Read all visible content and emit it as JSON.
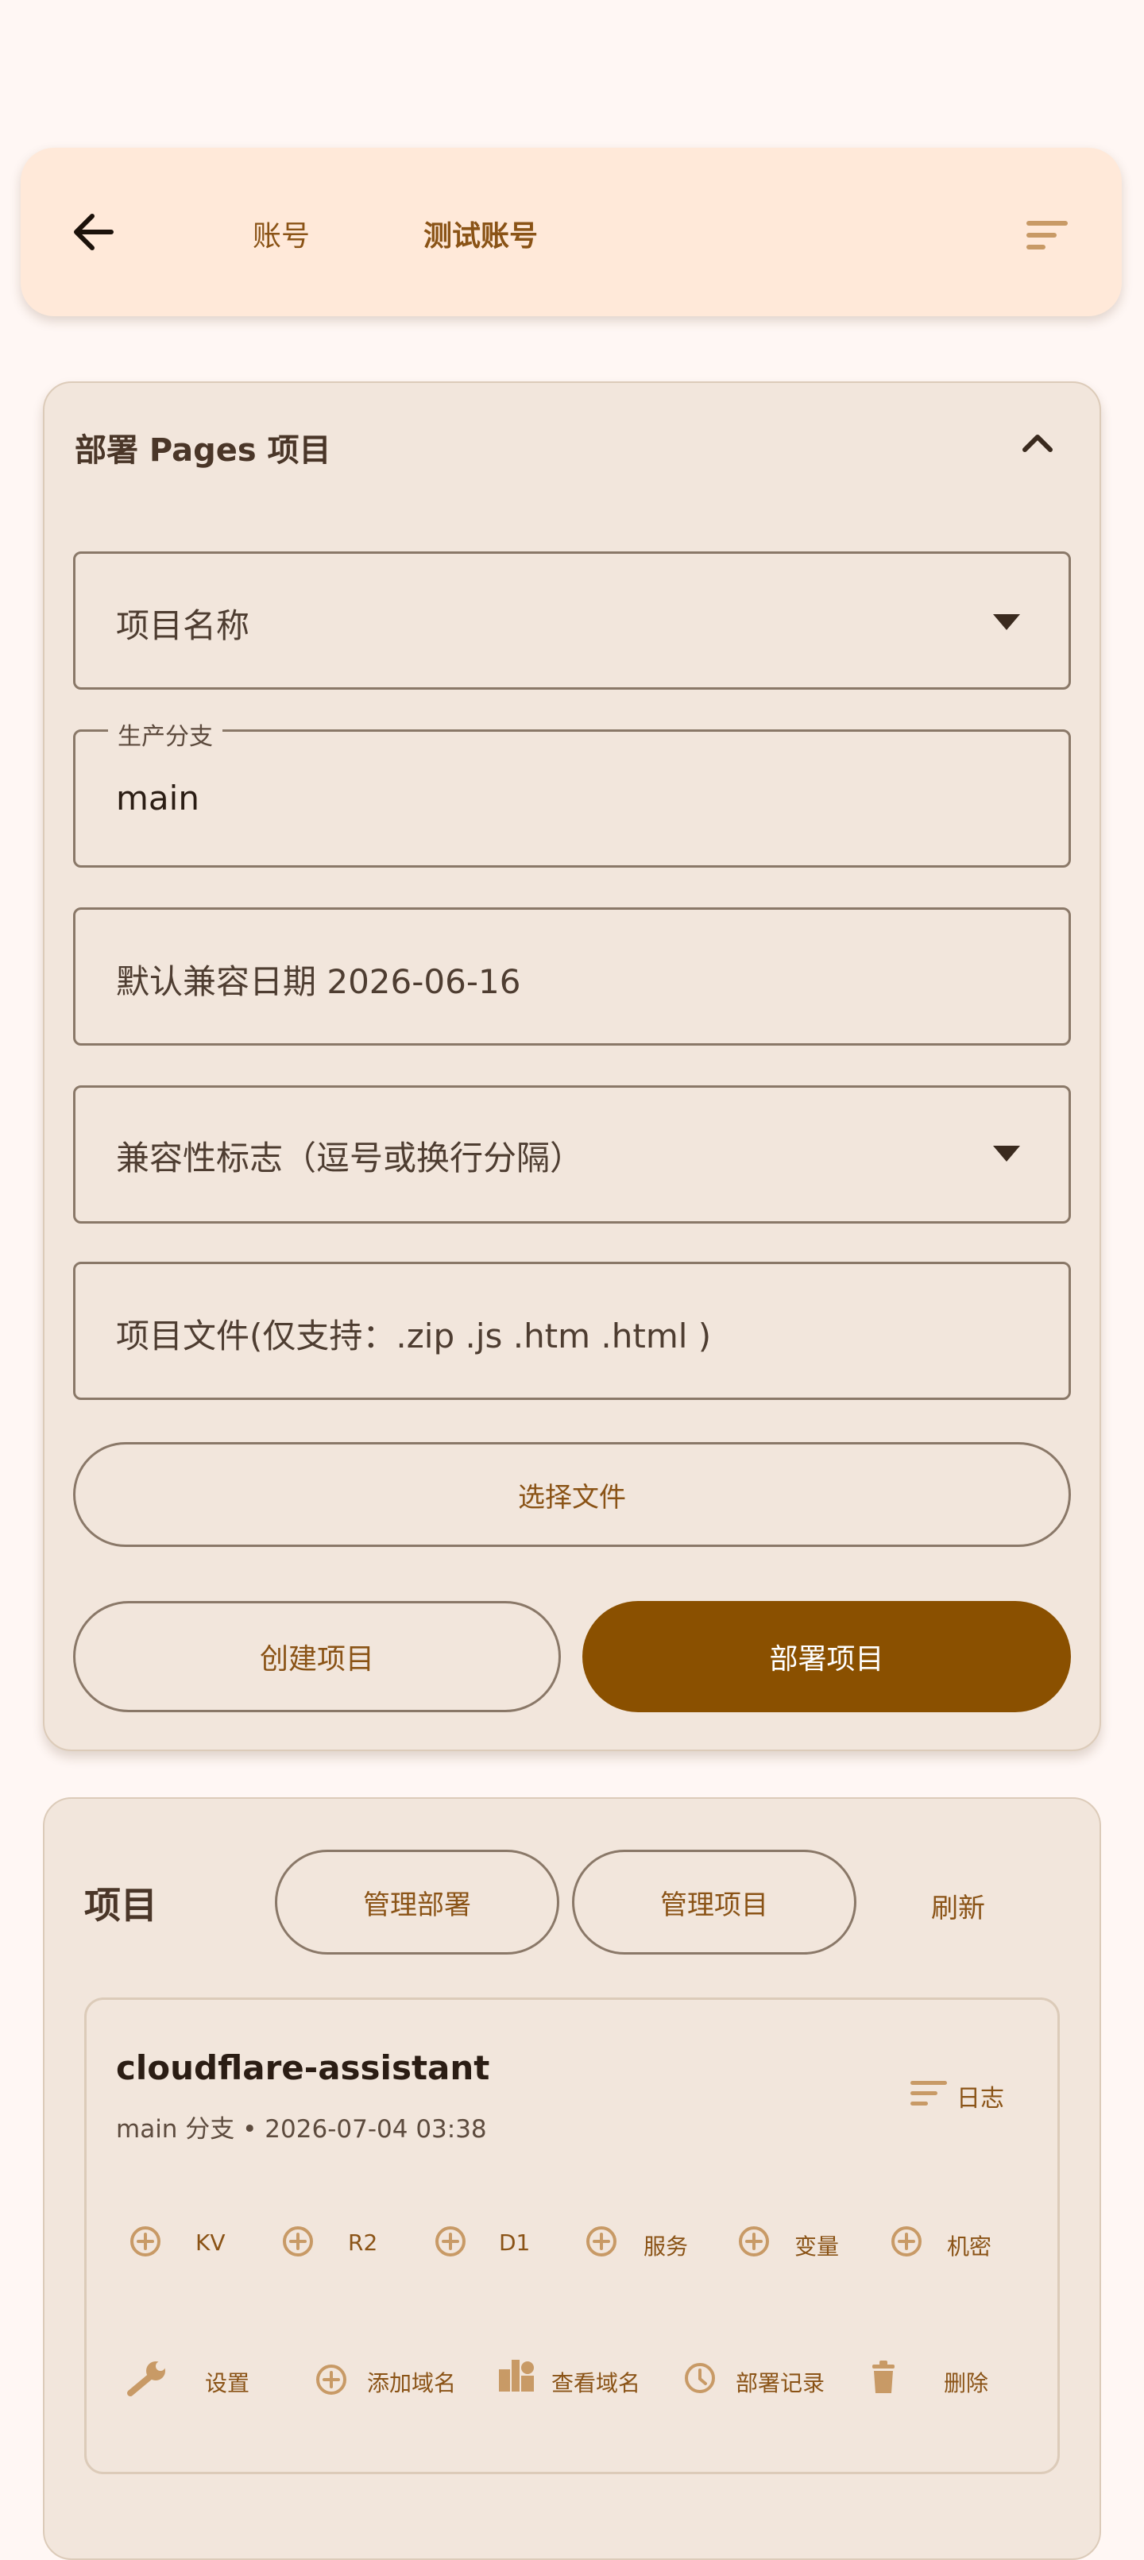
{
  "app_bar": {
    "tabs": [
      "账号",
      "测试账号"
    ]
  },
  "deploy_card": {
    "title": "部署 Pages 项目",
    "project_name_placeholder": "项目名称",
    "branch_label": "生产分支",
    "branch_value": "main",
    "compat_date": "默认兼容日期 2026-06-16",
    "compat_flags_placeholder": "兼容性标志（逗号或换行分隔）",
    "files_placeholder": "项目文件(仅支持：.zip .js .htm .html )",
    "choose_files": "选择文件",
    "create_project": "创建项目",
    "deploy_project": "部署项目"
  },
  "projects_card": {
    "title": "项目",
    "manage_deployments": "管理部署",
    "manage_projects": "管理项目",
    "refresh": "刷新",
    "project": {
      "name": "cloudflare-assistant",
      "meta": "main 分支 • 2026-07-04 03:38",
      "log_label": "日志",
      "bindings": [
        "KV",
        "R2",
        "D1",
        "服务",
        "变量",
        "机密"
      ],
      "actions": [
        "设置",
        "添加域名",
        "查看域名",
        "部署记录",
        "删除"
      ]
    }
  },
  "colors": {
    "accent": "#8a5000",
    "text_accent": "#8a5316",
    "app_bar_bg": "#ffe9d9",
    "card_bg": "#f2e6dc",
    "page_bg": "#fff7f4"
  },
  "icons": [
    "arrow-back-icon",
    "sort-menu-icon",
    "chevron-up-icon",
    "dropdown-caret-icon",
    "add-circle-icon",
    "wrench-icon",
    "domain-icon",
    "history-icon",
    "trash-icon"
  ]
}
